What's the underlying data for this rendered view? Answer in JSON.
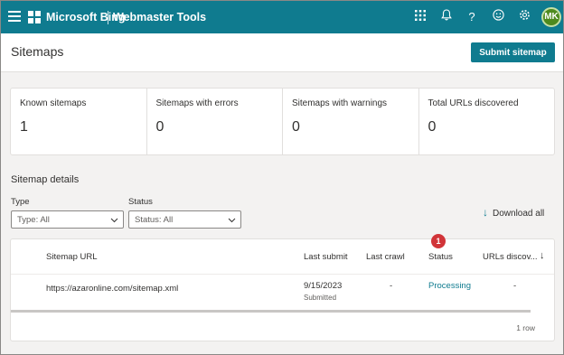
{
  "topbar": {
    "brand": "Microsoft Bing",
    "product": "Webmaster Tools",
    "avatar_initials": "MK",
    "icons": [
      "apps-grid-icon",
      "bell-icon",
      "help-icon",
      "smiley-icon",
      "settings-icon"
    ]
  },
  "page": {
    "title": "Sitemaps",
    "submit_label": "Submit sitemap"
  },
  "stats": [
    {
      "label": "Known sitemaps",
      "value": "1"
    },
    {
      "label": "Sitemaps with errors",
      "value": "0"
    },
    {
      "label": "Sitemaps with warnings",
      "value": "0"
    },
    {
      "label": "Total URLs discovered",
      "value": "0"
    }
  ],
  "details": {
    "title": "Sitemap details",
    "type_label": "Type",
    "type_value": "Type: All",
    "status_label": "Status",
    "status_value": "Status: All",
    "download_label": "Download all"
  },
  "table": {
    "columns": [
      "Sitemap URL",
      "Last submit",
      "Last crawl",
      "Status",
      "URLs discov..."
    ],
    "rows": [
      {
        "url": "https://azaronline.com/sitemap.xml",
        "last_submit": "9/15/2023",
        "submit_note": "Submitted",
        "last_crawl": "-",
        "status": "Processing",
        "urls": "-"
      }
    ],
    "row_count": "1 row",
    "badge": "1"
  },
  "colors": {
    "accent": "#0f7b8f",
    "badge": "#d13438",
    "avatar": "#4e8a1e"
  }
}
